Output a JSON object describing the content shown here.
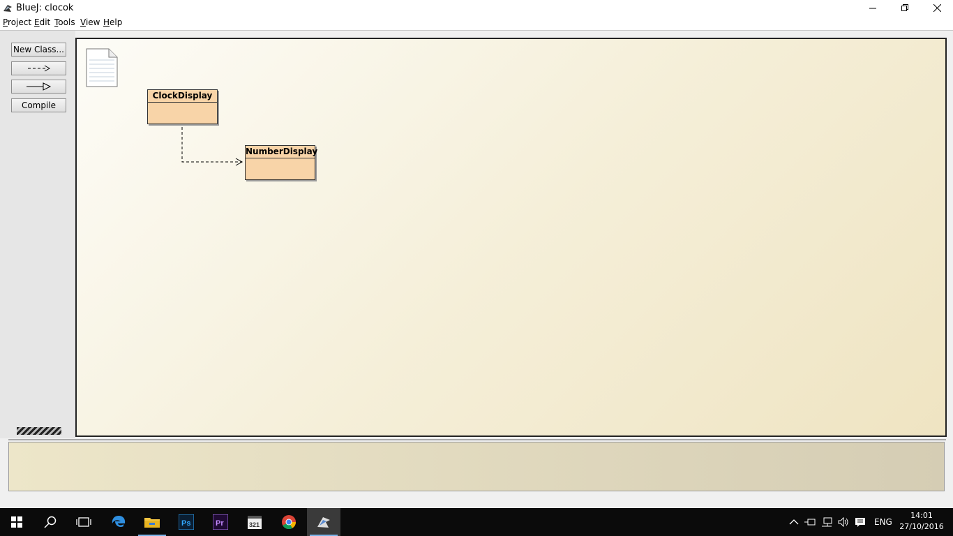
{
  "window": {
    "title": "BlueJ:  clocok"
  },
  "menu": [
    "Project",
    "Edit",
    "Tools",
    "View",
    "Help"
  ],
  "menu_mnemonics": [
    "P",
    "E",
    "T",
    "V",
    "H"
  ],
  "toolbar": {
    "new_class": "New Class...",
    "compile": "Compile"
  },
  "diagram": {
    "classes": [
      {
        "name": "ClockDisplay"
      },
      {
        "name": "NumberDisplay"
      }
    ],
    "relations": [
      {
        "from": "ClockDisplay",
        "to": "NumberDisplay",
        "type": "uses"
      }
    ]
  },
  "taskbar": {
    "apps": [
      "start-icon",
      "search-icon",
      "task-view-icon",
      "edge-icon",
      "file-explorer-icon",
      "photoshop-icon",
      "premiere-icon",
      "media-player-icon",
      "chrome-icon",
      "bluej-icon"
    ],
    "language": "ENG",
    "time": "14:01",
    "date": "27/10/2016"
  },
  "colors": {
    "class_fill": "#f8d4a8",
    "taskbar": "#0b0b0b",
    "accent": "#7ab3e8"
  }
}
